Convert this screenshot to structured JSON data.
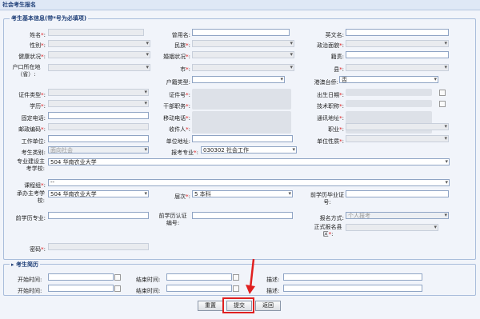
{
  "window": {
    "title": "社会考生报名"
  },
  "basic_info": {
    "legend": "考生基本信息(带*号为必填项)",
    "fields": {
      "name": "姓名",
      "former_name": "曾用名",
      "english_name": "英文名",
      "gender": "性别",
      "ethnicity": "民族",
      "political": "政治面貌",
      "health": "健康状况",
      "marital": "婚姻状况",
      "native": "籍贯",
      "hukou_province": "户口所在地（省）",
      "city": "市",
      "county": "县",
      "hukou_type": "户籍类型",
      "hk_macao_tw": "港澳台侨",
      "hk_macao_tw_value": "否",
      "id_type": "证件类型",
      "id_no": "证件号",
      "birth_date": "出生日期",
      "education": "学历",
      "cadre": "干部职务",
      "title": "技术职称",
      "phone": "固定电话",
      "mobile": "移动电话",
      "address": "通讯地址",
      "postcode": "邮政编码",
      "recipient": "收件人",
      "occupation": "职业",
      "employer": "工作单位",
      "employer_address": "单位地址",
      "employer_nature": "单位性质",
      "category": "考生类别",
      "category_value": "面向社会",
      "major": "报考专业",
      "major_value": "030302 社会工作",
      "major_school": "专业建设主考学校",
      "major_school_value": "504 华南农业大学",
      "course_group": "课程组",
      "course_group_value": "--",
      "exam_school": "承办主考学校",
      "exam_school_value": "504 华南农业大学",
      "level": "层次",
      "level_value": "5 本科",
      "prev_cert": "前学历毕业证号",
      "prev_major": "前学历专业",
      "prev_cert_id": "前学历认证编号",
      "reg_method": "报名方式",
      "reg_method_value": "个人报考",
      "formal_district": "正式报名县区",
      "password": "密码"
    }
  },
  "resume": {
    "legend": "考生简历",
    "start": "开始时间:",
    "end": "结束时间:",
    "desc": "描述:"
  },
  "buttons": {
    "reset": "重置",
    "submit": "提交",
    "back": "返回"
  },
  "colors": {
    "highlight": "#e02020",
    "legend": "#1f3f78"
  }
}
